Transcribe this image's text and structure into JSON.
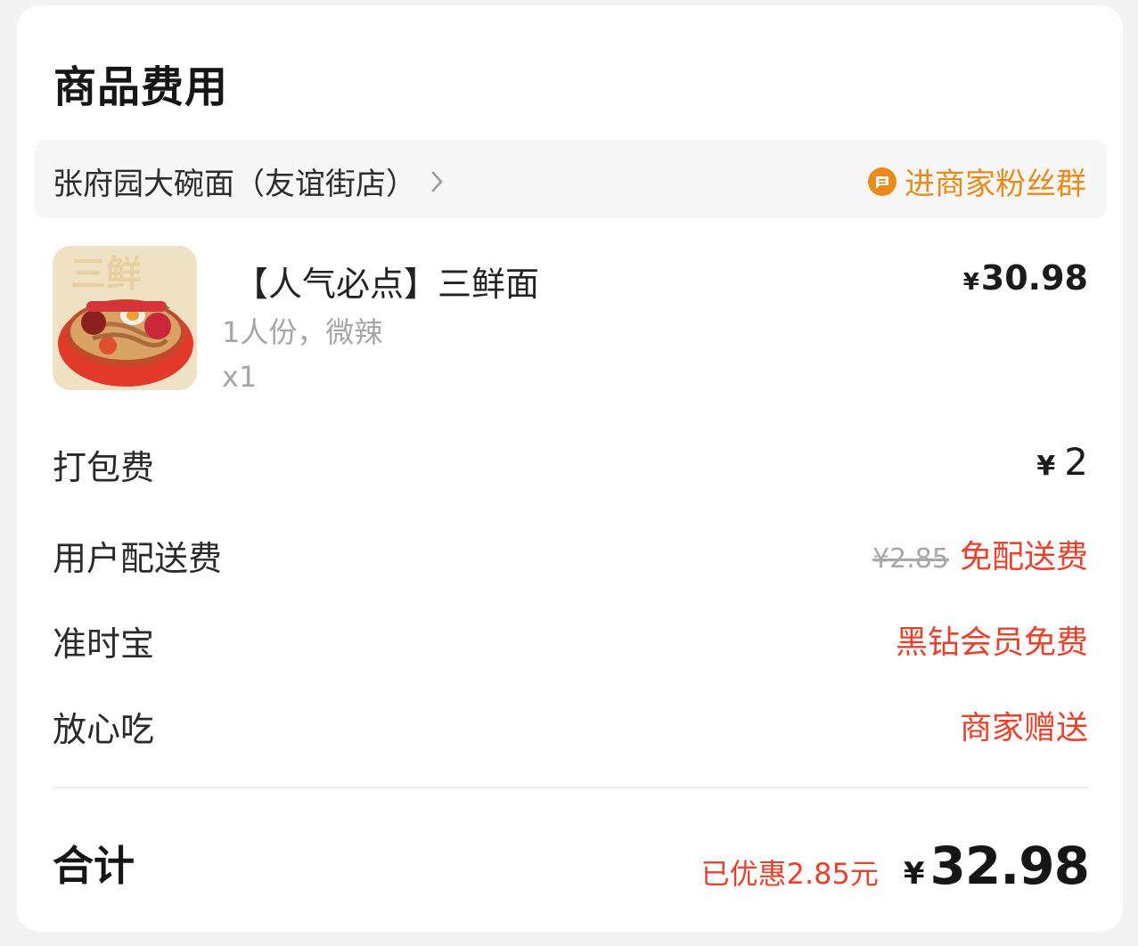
{
  "section_title": "商品费用",
  "shop": {
    "name": "张府园大碗面（友谊街店）",
    "fan_group_label": "进商家粉丝群"
  },
  "product": {
    "name": "【人气必点】三鲜面",
    "spec": "1人份，微辣",
    "qty": "x1",
    "currency": "¥",
    "price": "30.98",
    "thumb_text": "三鲜"
  },
  "fees": {
    "packaging": {
      "label": "打包费",
      "currency": "¥",
      "value": "2"
    },
    "delivery": {
      "label": "用户配送费",
      "original": "¥2.85",
      "value": "免配送费"
    },
    "ontime": {
      "label": "准时宝",
      "value": "黑钻会员免费"
    },
    "safe_eat": {
      "label": "放心吃",
      "value": "商家赠送"
    }
  },
  "total": {
    "label": "合计",
    "saved": "已优惠2.85元",
    "currency": "¥",
    "amount": "32.98"
  },
  "colors": {
    "accent_red": "#e8412c",
    "accent_orange": "#ea8a18"
  }
}
